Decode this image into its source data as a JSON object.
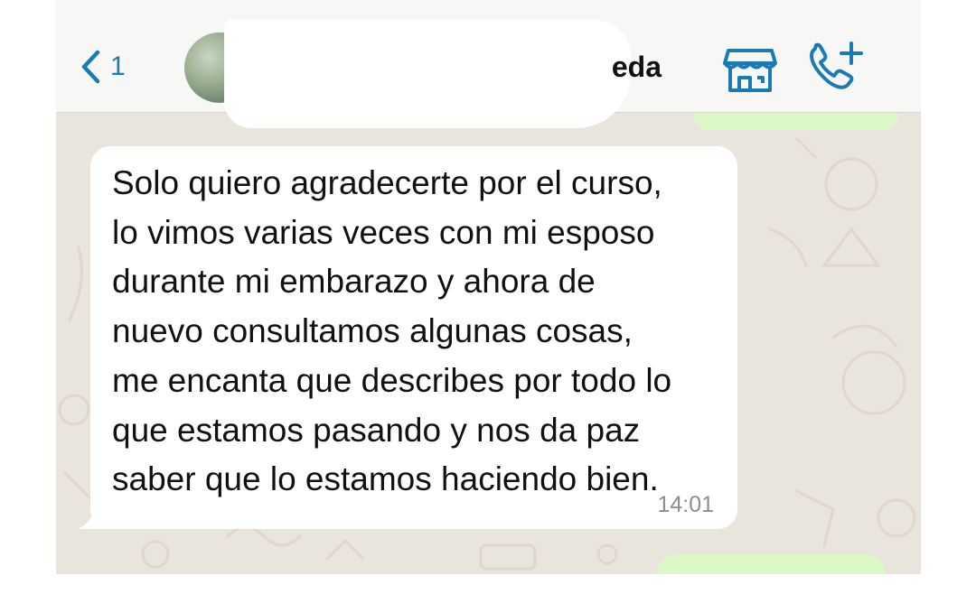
{
  "header": {
    "back_count": "1",
    "contact_name_visible": "eda"
  },
  "messages": {
    "incoming": {
      "text": "Solo quiero agradecerte por el curso,\nlo vimos varias veces con mi esposo\ndurante mi embarazo y ahora de\nnuevo consultamos algunas cosas,\nme encanta que describes por todo lo\nque estamos pasando y nos da paz\nsaber que lo estamos haciendo bien.",
      "time": "14:01"
    }
  },
  "colors": {
    "accent": "#1a7ab6",
    "outgoing_bubble": "#dcf8c6",
    "incoming_bubble": "#ffffff",
    "chat_background": "#e9e4dc"
  },
  "icons": {
    "back": "chevron-left-icon",
    "store": "store-icon",
    "call": "phone-plus-icon"
  }
}
